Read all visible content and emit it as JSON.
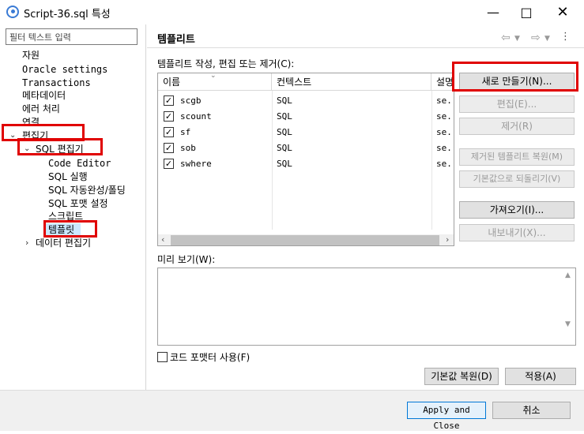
{
  "window": {
    "title": "Script-36.sql 특성"
  },
  "filter": {
    "placeholder": "필터 텍스트 입력"
  },
  "tree": {
    "items": [
      "자원",
      "Oracle settings",
      "Transactions",
      "메타데이터",
      "에러 처리",
      "연결",
      "편집기",
      "SQL 편집기",
      "Code Editor",
      "SQL 실행",
      "SQL 자동완성/폴딩",
      "SQL 포맷 설정",
      "스크립트",
      "템플릿",
      "데이터 편집기"
    ]
  },
  "page": {
    "title": "템플리트",
    "list_label": "템플리트 작성, 편집 또는 제거(C):",
    "preview_label": "미리 보기(W):",
    "code_formatter_label": "코드 포맷터 사용(F)"
  },
  "table": {
    "columns": [
      "이름",
      "컨텍스트",
      "설명"
    ],
    "rows": [
      {
        "name": "scgb",
        "context": "SQL",
        "desc": "se..."
      },
      {
        "name": "scount",
        "context": "SQL",
        "desc": "se..."
      },
      {
        "name": "sf",
        "context": "SQL",
        "desc": "se..."
      },
      {
        "name": "sob",
        "context": "SQL",
        "desc": "se..."
      },
      {
        "name": "swhere",
        "context": "SQL",
        "desc": "se..."
      }
    ]
  },
  "buttons": {
    "new": "새로 만들기(N)...",
    "edit": "편집(E)...",
    "remove": "제거(R)",
    "restore_removed": "제거된 템플리트 복원(M)",
    "revert_default": "기본값으로 되돌리기(V)",
    "import": "가져오기(I)...",
    "export": "내보내기(X)...",
    "restore_defaults": "기본값 복원(D)",
    "apply": "적용(A)",
    "apply_close": "Apply and Close",
    "cancel": "취소"
  },
  "colors": {
    "highlight": "#e00000",
    "focus": "#0078d7"
  }
}
